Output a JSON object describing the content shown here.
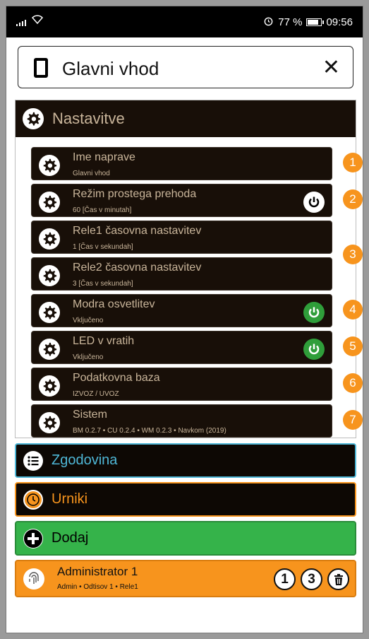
{
  "statusbar": {
    "battery_text": "77 %",
    "time": "09:56",
    "alarm_icon": "alarm-clock-icon"
  },
  "header": {
    "title": "Glavni vhod",
    "close_label": "✕"
  },
  "settings": {
    "title": "Nastavitve",
    "items": [
      {
        "label": "Ime naprave",
        "sub": "Glavni vhod",
        "badge": "1",
        "power": ""
      },
      {
        "label": "Režim prostega prehoda",
        "sub": "60 [Čas v minutah]",
        "badge": "2",
        "power": "white"
      },
      {
        "label": "Rele1 časovna nastavitev",
        "sub": "1 [Čas v sekundah]",
        "badge": "",
        "power": ""
      },
      {
        "label": "Rele2 časovna nastavitev",
        "sub": "3 [Čas v sekundah]",
        "badge": "",
        "power": ""
      },
      {
        "label": "Modra osvetlitev",
        "sub": "Vključeno",
        "badge": "4",
        "power": "green"
      },
      {
        "label": "LED v vratih",
        "sub": "Vključeno",
        "badge": "5",
        "power": "green"
      },
      {
        "label": "Podatkovna baza",
        "sub": "IZVOZ / UVOZ",
        "badge": "6",
        "power": ""
      },
      {
        "label": "Sistem",
        "sub": "BM 0.2.7 • CU 0.2.4 • WM 0.2.3 • Navkom (2019)",
        "badge": "7",
        "power": ""
      }
    ],
    "group_badge": "3"
  },
  "sections": {
    "history": "Zgodovina",
    "schedules": "Urniki",
    "add": "Dodaj"
  },
  "user": {
    "name": "Administrator 1",
    "sub": "Admin • Odtisov 1 • Rele1",
    "count1": "1",
    "count2": "3"
  },
  "colors": {
    "dark": "#180f08",
    "tan_text": "#c9b59a",
    "orange": "#f7941d",
    "cyan": "#4fb8d8",
    "green": "#35b34a",
    "power_green": "#2f9e3a"
  }
}
